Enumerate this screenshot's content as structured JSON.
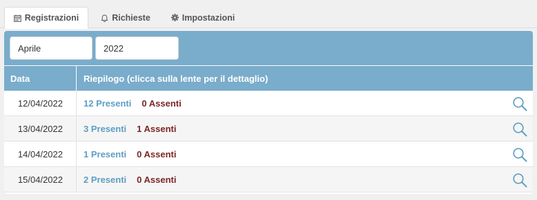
{
  "tabs": [
    {
      "label": "Registrazioni",
      "icon": "calendar-icon",
      "active": true
    },
    {
      "label": "Richieste",
      "icon": "bell-icon",
      "active": false
    },
    {
      "label": "Impostazioni",
      "icon": "gear-icon",
      "active": false
    }
  ],
  "filters": {
    "month": "Aprile",
    "year": "2022"
  },
  "table": {
    "headers": [
      "Data",
      "Riepilogo (clicca sulla lente per il dettaglio)"
    ],
    "rows": [
      {
        "date": "12/04/2022",
        "present": "12 Presenti",
        "absent": "0 Assenti"
      },
      {
        "date": "13/04/2022",
        "present": "3 Presenti",
        "absent": "1 Assenti"
      },
      {
        "date": "14/04/2022",
        "present": "1 Presenti",
        "absent": "0 Assenti"
      },
      {
        "date": "15/04/2022",
        "present": "2 Presenti",
        "absent": "0 Assenti"
      }
    ],
    "row_icon": "search-icon"
  },
  "colors": {
    "header_bg": "#7aaccb",
    "present": "#5e9ec4",
    "absent": "#7a2626",
    "lens": "#5e9ec4"
  }
}
